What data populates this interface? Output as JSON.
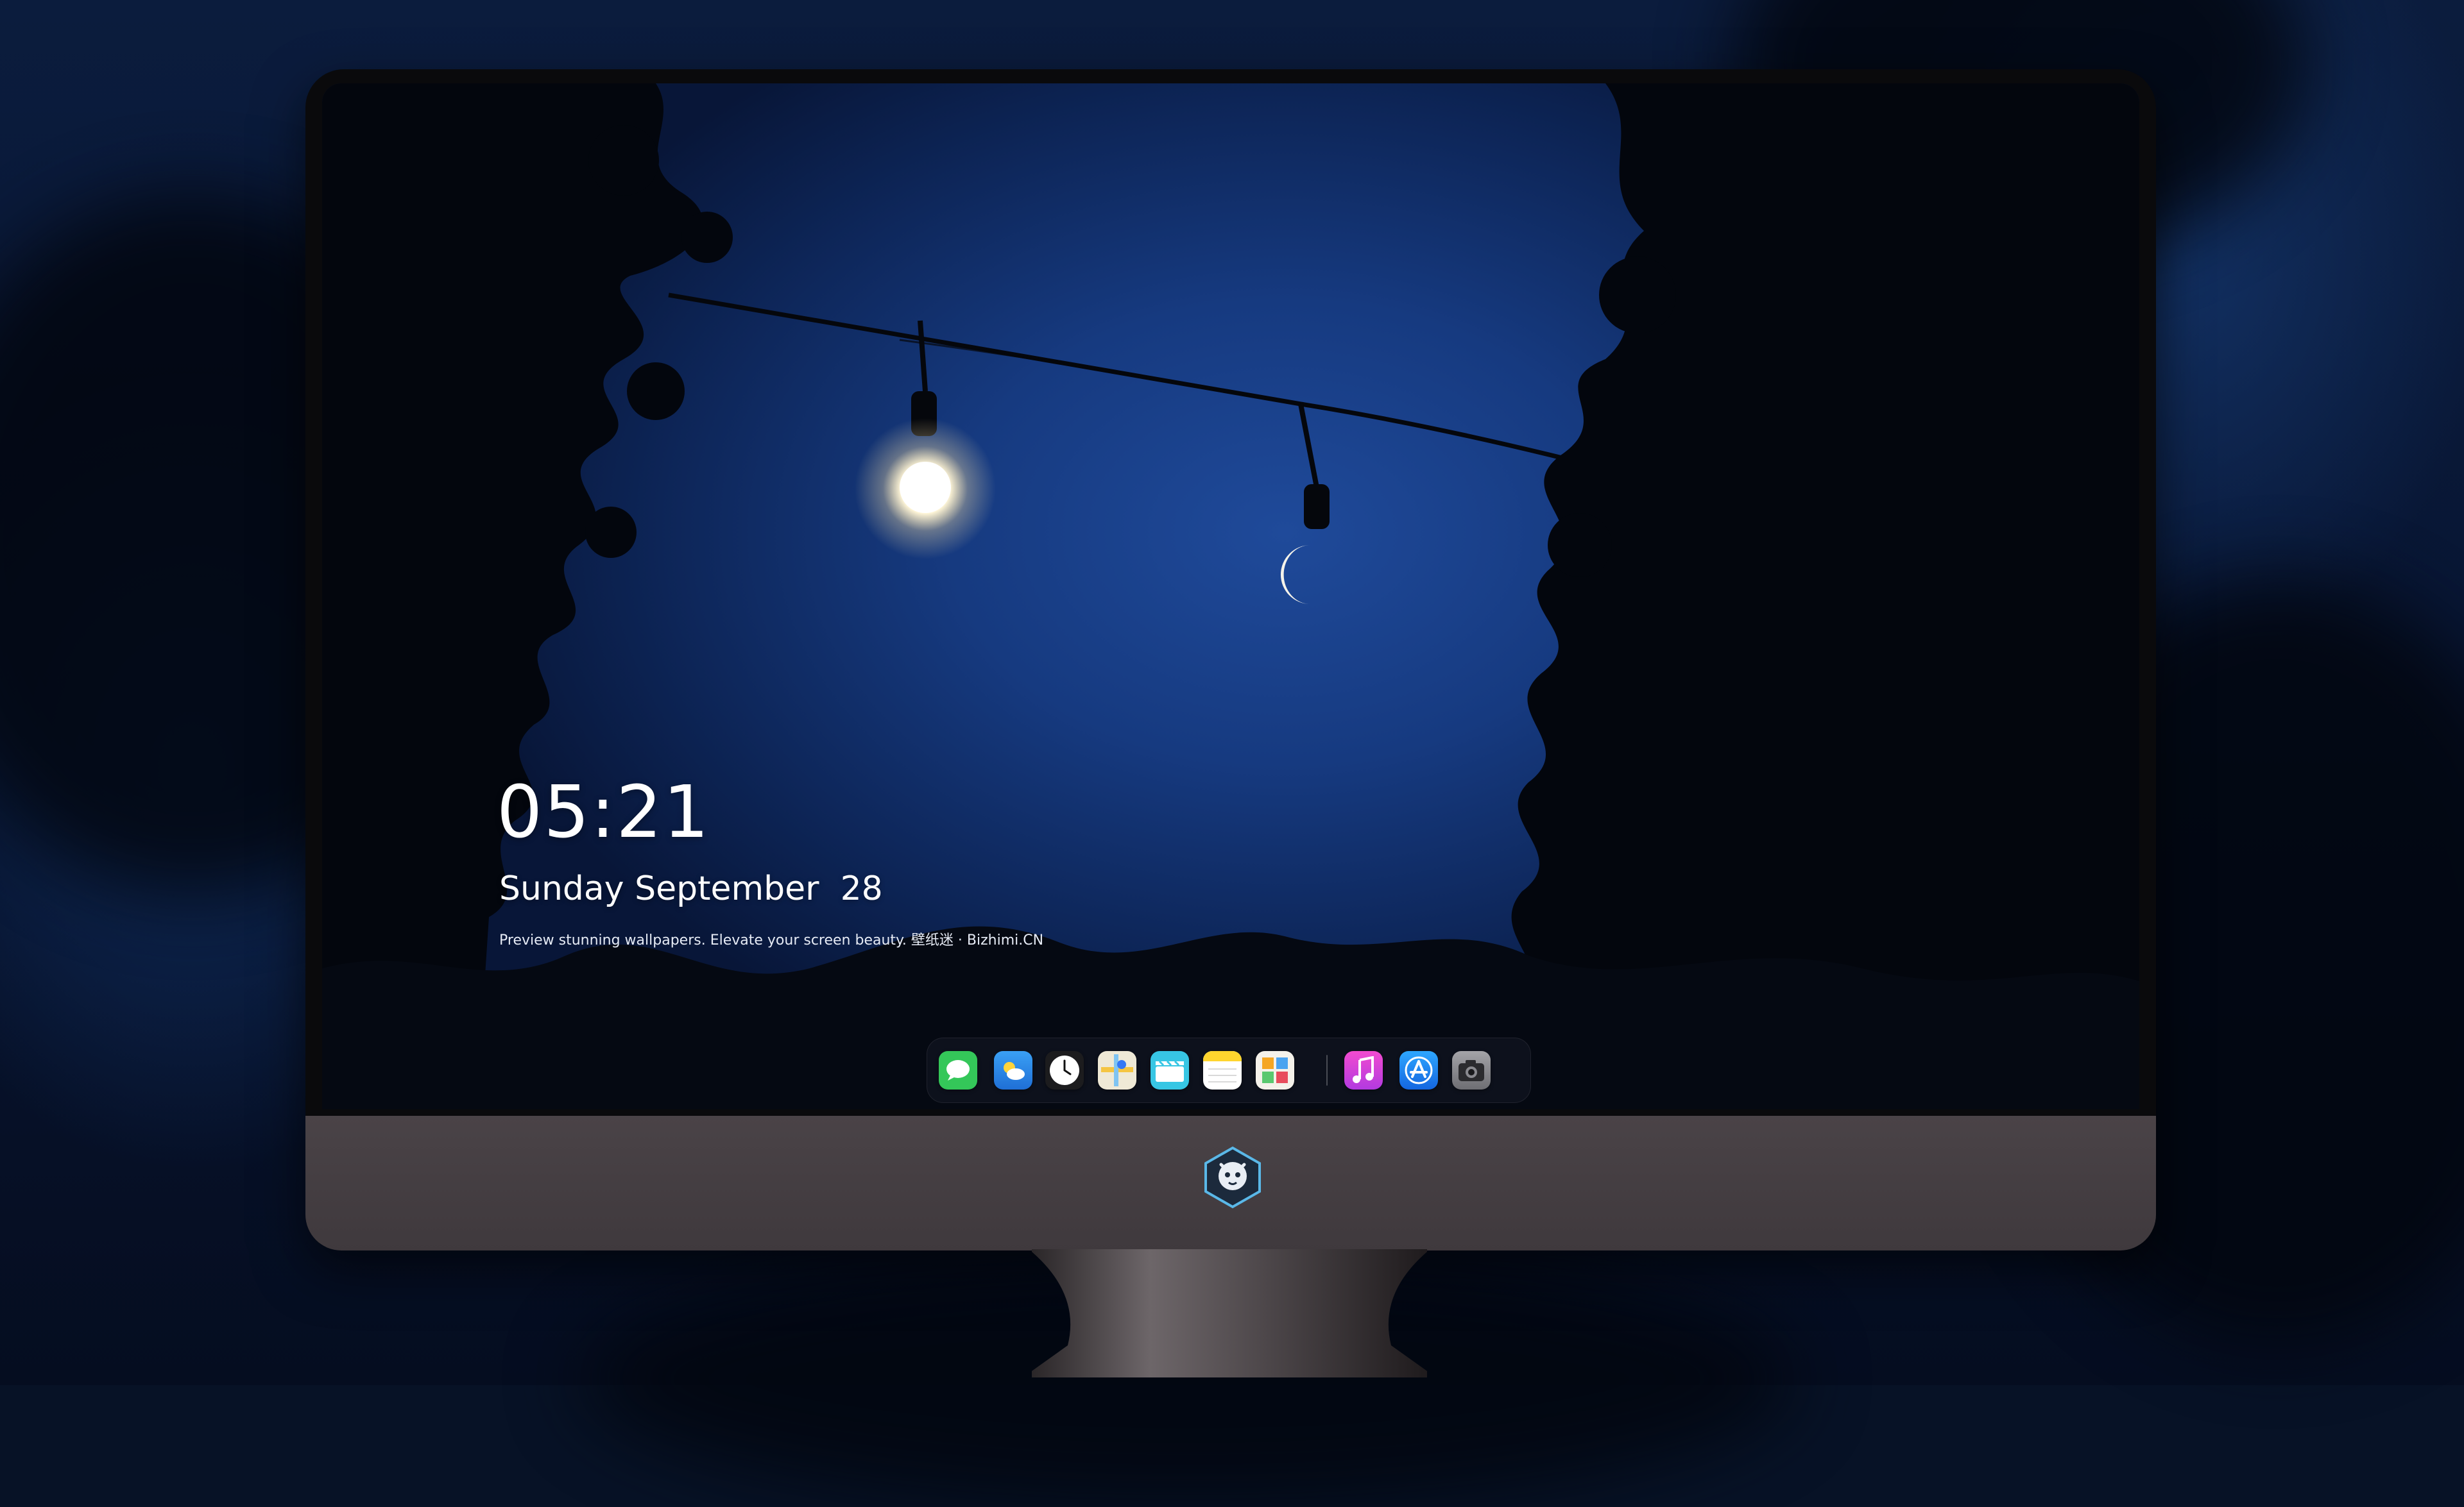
{
  "lockscreen": {
    "time": "05:21",
    "date": "Sunday September  28",
    "tagline": "Preview stunning wallpapers. Elevate your screen beauty. 壁纸迷 · Bizhimi.CN"
  },
  "dock": {
    "apps": [
      {
        "name": "messages-icon",
        "color": "#34c759"
      },
      {
        "name": "weather-icon",
        "color": "#2f8ef0"
      },
      {
        "name": "clock-icon",
        "color": "#f2f2f2"
      },
      {
        "name": "maps-icon",
        "color": "#e9e6d8"
      },
      {
        "name": "clips-icon",
        "color": "#36c8e6"
      },
      {
        "name": "notes-icon",
        "color": "#ffd52e"
      },
      {
        "name": "calendar-icon",
        "color": "#f4f1ea"
      },
      {
        "name": "music-icon",
        "color": "#e040b8"
      },
      {
        "name": "app-store-icon",
        "color": "#1e88f0"
      },
      {
        "name": "camera-icon",
        "color": "#8e8e93"
      }
    ]
  },
  "colors": {
    "sky": "#163a80",
    "chin": "#4a4347",
    "bezel": "#0a0a0c"
  }
}
